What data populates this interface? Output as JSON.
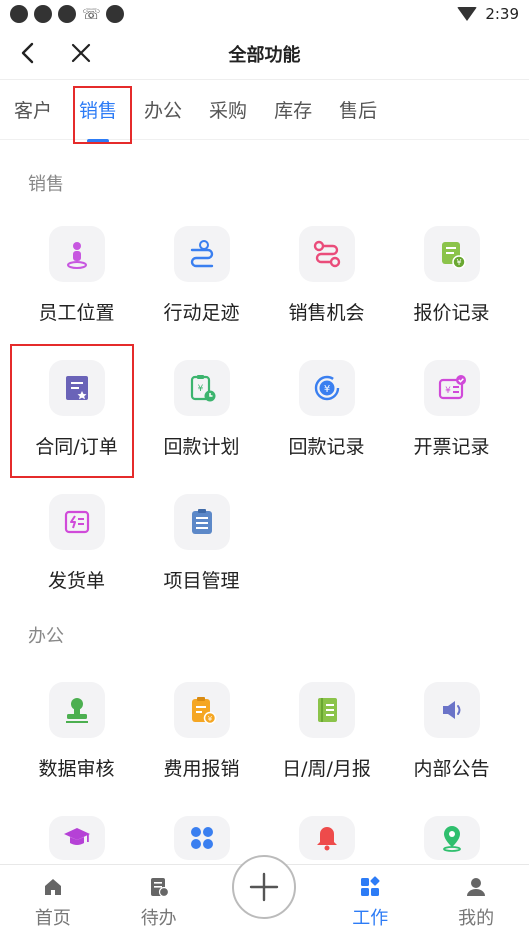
{
  "status": {
    "time": "2:39"
  },
  "header": {
    "title": "全部功能"
  },
  "tabs": [
    {
      "label": "客户"
    },
    {
      "label": "销售"
    },
    {
      "label": "办公"
    },
    {
      "label": "采购"
    },
    {
      "label": "库存"
    },
    {
      "label": "售后"
    }
  ],
  "sales": {
    "title": "销售",
    "items": [
      {
        "label": "员工位置",
        "icon": "person-location-icon",
        "color": "#c757e0"
      },
      {
        "label": "行动足迹",
        "icon": "route-icon",
        "color": "#3a7ff0"
      },
      {
        "label": "销售机会",
        "icon": "path-icon",
        "color": "#ea4c7a"
      },
      {
        "label": "报价记录",
        "icon": "quote-icon",
        "color": "#8bc34a"
      },
      {
        "label": "合同/订单",
        "icon": "contract-icon",
        "color": "#6a63b8"
      },
      {
        "label": "回款计划",
        "icon": "payment-plan-icon",
        "color": "#3cb46e"
      },
      {
        "label": "回款记录",
        "icon": "payment-record-icon",
        "color": "#3a7ff0"
      },
      {
        "label": "开票记录",
        "icon": "invoice-icon",
        "color": "#d04ad9"
      },
      {
        "label": "发货单",
        "icon": "shipping-icon",
        "color": "#d04ad9"
      },
      {
        "label": "项目管理",
        "icon": "clipboard-icon",
        "color": "#5c88c8"
      }
    ]
  },
  "office": {
    "title": "办公",
    "items": [
      {
        "label": "数据审核",
        "icon": "stamp-icon",
        "color": "#4caf50"
      },
      {
        "label": "费用报销",
        "icon": "expense-icon",
        "color": "#f5a623"
      },
      {
        "label": "日/周/月报",
        "icon": "report-icon",
        "color": "#8bc34a"
      },
      {
        "label": "内部公告",
        "icon": "speaker-icon",
        "color": "#6a73c8"
      }
    ],
    "partial_icons": [
      {
        "icon": "graduation-cap-icon",
        "color": "#b541d6"
      },
      {
        "icon": "apps-icon",
        "color": "#3a7ff0"
      },
      {
        "icon": "bell-icon",
        "color": "#ee4b4b"
      },
      {
        "icon": "map-pin-icon",
        "color": "#2fbf6e"
      }
    ]
  },
  "bottom_nav": {
    "home": "首页",
    "todo": "待办",
    "work": "工作",
    "mine": "我的"
  }
}
